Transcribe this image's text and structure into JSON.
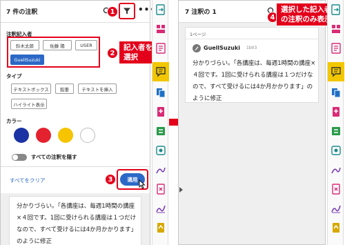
{
  "left_panel": {
    "title": "7 件の注釈",
    "sections": {
      "author_label": "注釈記入者",
      "authors": [
        "鈴木太郎",
        "佐藤 陽",
        "USER",
        "GuellSuzuki"
      ],
      "type_label": "タイプ",
      "types": [
        "テキストボックス",
        "鉛筆",
        "テキストを挿入",
        "ハイライト表示"
      ],
      "color_label": "カラー",
      "colors": [
        "#1b33a3",
        "#e4222f",
        "#f6c400",
        "#ffffff"
      ],
      "toggle_label": "すべての注釈を隠す"
    },
    "footer": {
      "clear_label": "すべてをクリア",
      "apply_label": "適用"
    },
    "background_comment": "分かりづらい。「各講座は、毎週1時間の講座×４回です。1回に受けられる講座は１つだけなので、すべて受けるには4か月かかります」のように修正"
  },
  "callouts": {
    "badge1": "1",
    "badge2": "2",
    "badge3": "3",
    "badge4": "4",
    "select_author": "記入者を\n選択",
    "only_selected": "選択した記入者\nの注釈のみ表示"
  },
  "right_panel": {
    "title": "7 注釈の 1",
    "page_label": "1ページ",
    "author": "GuellSuzuki",
    "time": "1b03",
    "comment": "分かりづらい。「各講座は、毎週1時間の講座×４回です。1回に受けられる講座は１つだけなので、すべて受けるには4か月かかります」のように修正"
  },
  "icons": {
    "search": "search-icon",
    "filter": "filter-icon",
    "more": "more-icon",
    "arrow": "right-arrow-icon"
  },
  "accent_colors": {
    "callout_red": "#e3001b",
    "primary_blue": "#2c69c7",
    "tool_selected": "#f2c700"
  }
}
